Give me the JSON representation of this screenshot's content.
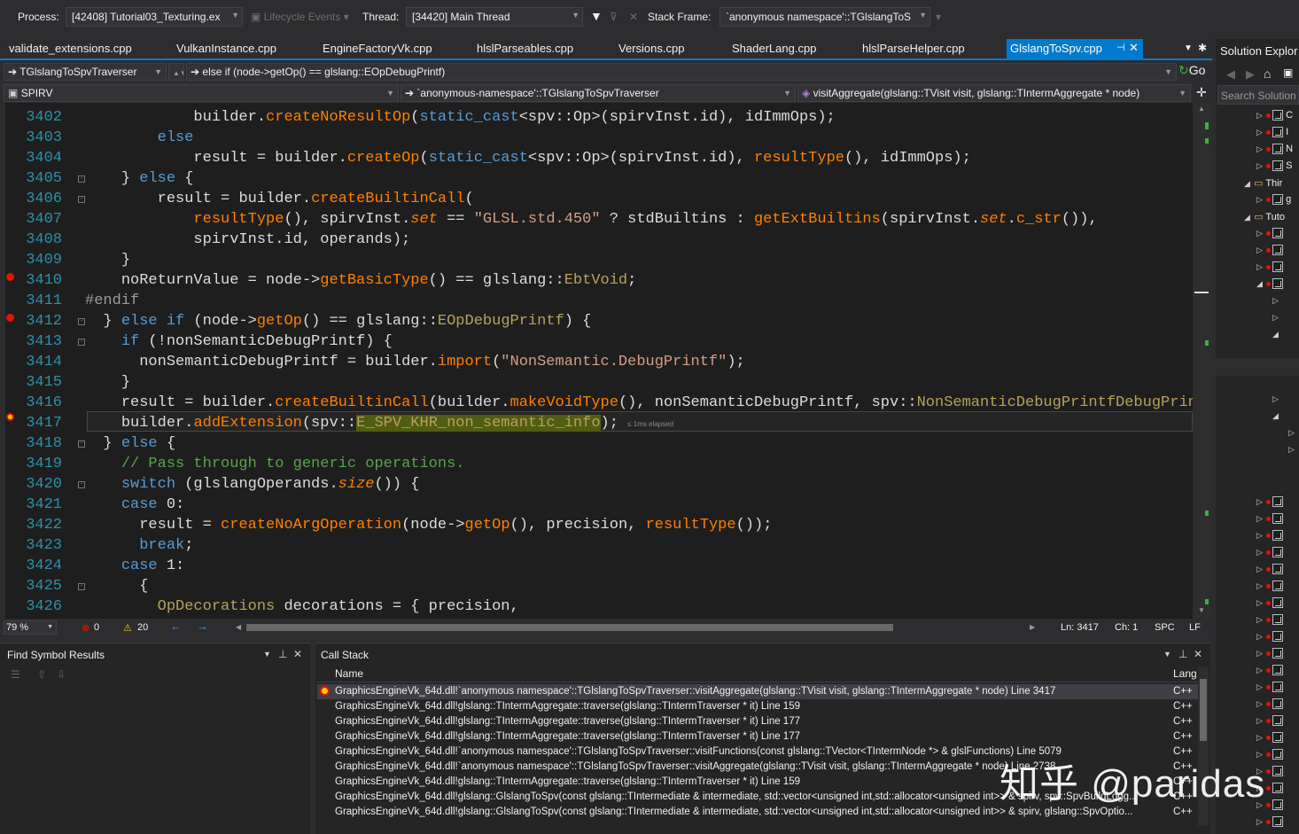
{
  "debug_toolbar": {
    "process_label": "Process:",
    "process_value": "[42408] Tutorial03_Texturing.ex",
    "lifecycle_label": "Lifecycle Events",
    "thread_label": "Thread:",
    "thread_value": "[34420] Main Thread",
    "stack_frame_label": "Stack Frame:",
    "stack_frame_value": "`anonymous namespace'::TGlslangToS"
  },
  "doc_tabs": [
    {
      "label": "validate_extensions.cpp"
    },
    {
      "label": "VulkanInstance.cpp"
    },
    {
      "label": "EngineFactoryVk.cpp"
    },
    {
      "label": "hlslParseables.cpp"
    },
    {
      "label": "Versions.cpp"
    },
    {
      "label": "ShaderLang.cpp"
    },
    {
      "label": "hlslParseHelper.cpp"
    },
    {
      "label": "GlslangToSpv.cpp",
      "active": true
    }
  ],
  "nav_bar": {
    "scope_combo": "TGlslangToSpvTraverser",
    "statement_combo": "else if (node->getOp() == glslang::EOpDebugPrintf)",
    "go_label": "Go",
    "project_combo": "SPIRV",
    "class_combo": "`anonymous-namespace'::TGlslangToSpvTraverser",
    "member_combo": "visitAggregate(glslang::TVisit visit, glslang::TIntermAggregate * node)"
  },
  "editor": {
    "line_numbers": [
      "3402",
      "3403",
      "3404",
      "3405",
      "3406",
      "3407",
      "3408",
      "3409",
      "3410",
      "3411",
      "3412",
      "3413",
      "3414",
      "3415",
      "3416",
      "3417",
      "3418",
      "3419",
      "3420",
      "3421",
      "3422",
      "3423",
      "3424",
      "3425",
      "3426"
    ],
    "elapsed_hint": "≤ 1ms elapsed"
  },
  "editor_status": {
    "zoom": "79 %",
    "errors": "0",
    "warnings": "20",
    "line": "Ln: 3417",
    "col": "Ch: 1",
    "spacing": "SPC",
    "line_ending": "LF"
  },
  "find_symbol_panel": {
    "title": "Find Symbol Results"
  },
  "call_stack_panel": {
    "title": "Call Stack",
    "col_name": "Name",
    "col_lang": "Lang",
    "rows": [
      {
        "name": "GraphicsEngineVk_64d.dll!`anonymous namespace'::TGlslangToSpvTraverser::visitAggregate(glslang::TVisit visit, glslang::TIntermAggregate * node) Line 3417",
        "lang": "C++",
        "current": true
      },
      {
        "name": "GraphicsEngineVk_64d.dll!glslang::TIntermAggregate::traverse(glslang::TIntermTraverser * it) Line 159",
        "lang": "C++"
      },
      {
        "name": "GraphicsEngineVk_64d.dll!glslang::TIntermAggregate::traverse(glslang::TIntermTraverser * it) Line 177",
        "lang": "C++"
      },
      {
        "name": "GraphicsEngineVk_64d.dll!glslang::TIntermAggregate::traverse(glslang::TIntermTraverser * it) Line 177",
        "lang": "C++"
      },
      {
        "name": "GraphicsEngineVk_64d.dll!`anonymous namespace'::TGlslangToSpvTraverser::visitFunctions(const glslang::TVector<TIntermNode *> & glslFunctions) Line 5079",
        "lang": "C++"
      },
      {
        "name": "GraphicsEngineVk_64d.dll!`anonymous namespace'::TGlslangToSpvTraverser::visitAggregate(glslang::TVisit visit, glslang::TIntermAggregate * node) Line 2738",
        "lang": "C++"
      },
      {
        "name": "GraphicsEngineVk_64d.dll!glslang::TIntermAggregate::traverse(glslang::TIntermTraverser * it) Line 159",
        "lang": "C++"
      },
      {
        "name": "GraphicsEngineVk_64d.dll!glslang::GlslangToSpv(const glslang::TIntermediate & intermediate, std::vector<unsigned int,std::allocator<unsigned int>> & spirv, spv::SpvBuildLogg...",
        "lang": "C++"
      },
      {
        "name": "GraphicsEngineVk_64d.dll!glslang::GlslangToSpv(const glslang::TIntermediate & intermediate, std::vector<unsigned int,std::allocator<unsigned int>> & spirv, glslang::SpvOptio...",
        "lang": "C++"
      }
    ]
  },
  "solution_explorer": {
    "title": "Solution Explor",
    "search_placeholder": "Search Solution",
    "folder_items": [
      "Thir",
      "Tuto"
    ],
    "partial_items": [
      "C",
      "I",
      "N",
      "S",
      "g"
    ]
  },
  "watermark": "知乎 @paridas",
  "colors": {
    "accent": "#007acc",
    "keyword": "#569cd6",
    "function": "#ff8000",
    "string": "#d69d85",
    "comment": "#57a64a",
    "line_number": "#2b91af",
    "breakpoint": "#e51400"
  }
}
